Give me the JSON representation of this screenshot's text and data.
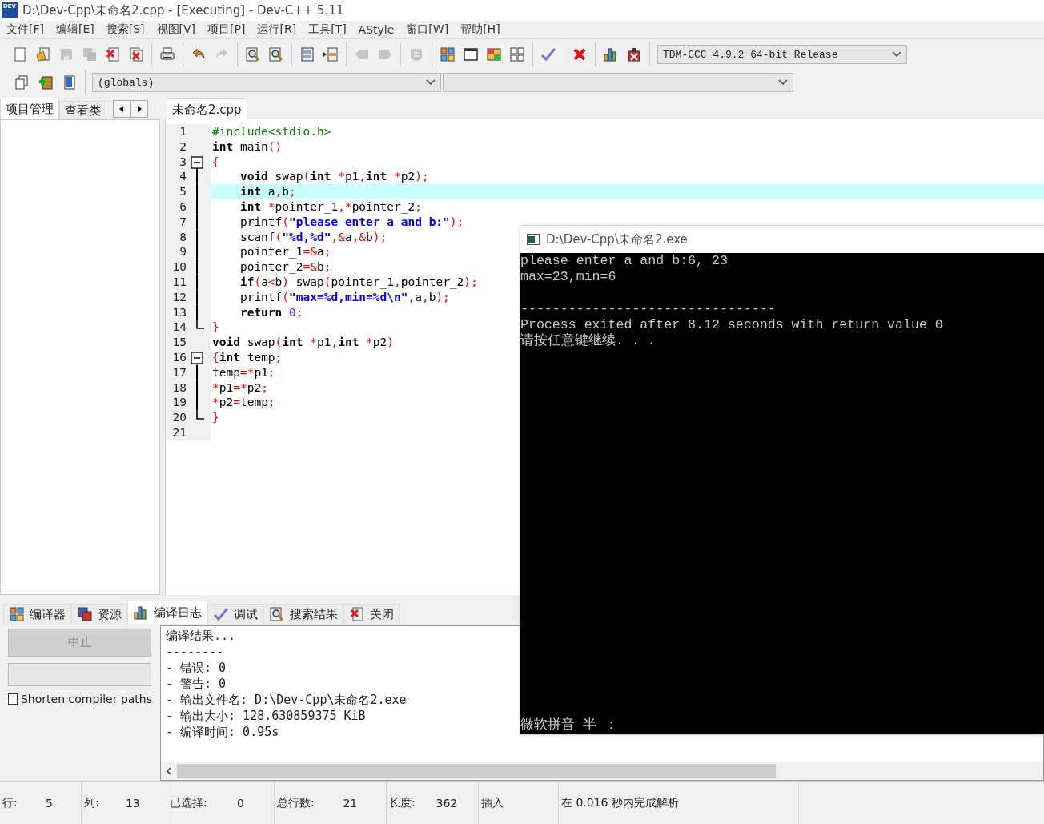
{
  "window": {
    "logo": "DEV",
    "title": "D:\\Dev-Cpp\\未命名2.cpp - [Executing] - Dev-C++ 5.11"
  },
  "menu": [
    "文件[F]",
    "编辑[E]",
    "搜索[S]",
    "视图[V]",
    "项目[P]",
    "运行[R]",
    "工具[T]",
    "AStyle",
    "窗口[W]",
    "帮助[H]"
  ],
  "toolbar": [
    [
      {
        "kind": "new",
        "disabled": false
      },
      {
        "kind": "open",
        "disabled": false
      },
      {
        "kind": "save",
        "disabled": true
      },
      {
        "kind": "saveall",
        "disabled": true
      },
      {
        "kind": "close",
        "disabled": false
      },
      {
        "kind": "closeall",
        "disabled": false
      }
    ],
    [
      {
        "kind": "print",
        "disabled": false
      }
    ],
    [
      {
        "kind": "undo",
        "disabled": false
      },
      {
        "kind": "redo",
        "disabled": true
      }
    ],
    [
      {
        "kind": "find",
        "disabled": false
      },
      {
        "kind": "replace",
        "disabled": false
      }
    ],
    [
      {
        "kind": "list",
        "disabled": false
      },
      {
        "kind": "goto",
        "disabled": false
      }
    ],
    [
      {
        "kind": "prev",
        "disabled": true
      },
      {
        "kind": "next",
        "disabled": true
      }
    ],
    [
      {
        "kind": "shield",
        "disabled": true
      }
    ],
    [
      {
        "kind": "colorgrid",
        "disabled": false
      },
      {
        "kind": "window",
        "disabled": false
      },
      {
        "kind": "palette",
        "disabled": false
      },
      {
        "kind": "grid",
        "disabled": false
      }
    ],
    [
      {
        "kind": "check",
        "disabled": false
      }
    ],
    [
      {
        "kind": "cross",
        "disabled": false
      }
    ],
    [
      {
        "kind": "chart",
        "disabled": false
      },
      {
        "kind": "chartcross",
        "disabled": false
      }
    ]
  ],
  "compiler": "TDM-GCC 4.9.2 64-bit Release",
  "toolbar2": [
    {
      "kind": "project",
      "disabled": false
    },
    {
      "kind": "add",
      "disabled": false
    },
    {
      "kind": "book",
      "disabled": false
    }
  ],
  "scope": "(globals)",
  "left_tabs": [
    {
      "label": "项目管理",
      "selected": true
    },
    {
      "label": "查看类",
      "selected": false
    }
  ],
  "editor_tabs": [
    {
      "label": "未命名2.cpp",
      "selected": true
    }
  ],
  "code": [
    {
      "number": "1",
      "current": false,
      "segments": [
        {
          "kind": "pp",
          "text": "#include<stdio.h>"
        }
      ]
    },
    {
      "number": "2",
      "current": false,
      "segments": [
        {
          "kind": "kw",
          "text": "int"
        },
        {
          "kind": "id",
          "text": " main"
        },
        {
          "kind": "sym",
          "text": "()"
        }
      ]
    },
    {
      "number": "3",
      "current": false,
      "expanded": true,
      "segments": [
        {
          "kind": "sym",
          "text": "{"
        }
      ],
      "children": [
        {
          "number": "4",
          "current": false,
          "segments": [
            {
              "kind": "kw",
              "text": "    void"
            },
            {
              "kind": "id",
              "text": " swap"
            },
            {
              "kind": "sym",
              "text": "("
            },
            {
              "kind": "kw",
              "text": "int "
            },
            {
              "kind": "sym",
              "text": "*"
            },
            {
              "kind": "id",
              "text": "p1"
            },
            {
              "kind": "sym",
              "text": ","
            },
            {
              "kind": "kw",
              "text": "int "
            },
            {
              "kind": "sym",
              "text": "*"
            },
            {
              "kind": "id",
              "text": "p2"
            },
            {
              "kind": "sym",
              "text": ");"
            }
          ]
        },
        {
          "number": "5",
          "current": true,
          "segments": [
            {
              "kind": "kw",
              "text": "    int"
            },
            {
              "kind": "id",
              "text": " a"
            },
            {
              "kind": "sym",
              "text": ","
            },
            {
              "kind": "id",
              "text": "b"
            },
            {
              "kind": "sym",
              "text": ";"
            }
          ]
        },
        {
          "number": "6",
          "current": false,
          "segments": [
            {
              "kind": "kw",
              "text": "    int "
            },
            {
              "kind": "sym",
              "text": "*"
            },
            {
              "kind": "id",
              "text": "pointer_1"
            },
            {
              "kind": "sym",
              "text": ",*"
            },
            {
              "kind": "id",
              "text": "pointer_2"
            },
            {
              "kind": "sym",
              "text": ";"
            }
          ]
        },
        {
          "number": "7",
          "current": false,
          "segments": [
            {
              "kind": "id",
              "text": "    printf"
            },
            {
              "kind": "sym",
              "text": "("
            },
            {
              "kind": "str",
              "text": "\"please enter a and b:\""
            },
            {
              "kind": "sym",
              "text": ");"
            }
          ]
        },
        {
          "number": "8",
          "current": false,
          "segments": [
            {
              "kind": "id",
              "text": "    scanf"
            },
            {
              "kind": "sym",
              "text": "("
            },
            {
              "kind": "str",
              "text": "\"%d,%d\""
            },
            {
              "kind": "sym",
              "text": ",&"
            },
            {
              "kind": "id",
              "text": "a"
            },
            {
              "kind": "sym",
              "text": ",&"
            },
            {
              "kind": "id",
              "text": "b"
            },
            {
              "kind": "sym",
              "text": ");"
            }
          ]
        },
        {
          "number": "9",
          "current": false,
          "segments": [
            {
              "kind": "id",
              "text": "    pointer_1"
            },
            {
              "kind": "sym",
              "text": "=&"
            },
            {
              "kind": "id",
              "text": "a"
            },
            {
              "kind": "sym",
              "text": ";"
            }
          ]
        },
        {
          "number": "10",
          "current": false,
          "segments": [
            {
              "kind": "id",
              "text": "    pointer_2"
            },
            {
              "kind": "sym",
              "text": "=&"
            },
            {
              "kind": "id",
              "text": "b"
            },
            {
              "kind": "sym",
              "text": ";"
            }
          ]
        },
        {
          "number": "11",
          "current": false,
          "segments": [
            {
              "kind": "kw",
              "text": "    if"
            },
            {
              "kind": "sym",
              "text": "("
            },
            {
              "kind": "id",
              "text": "a"
            },
            {
              "kind": "sym",
              "text": "<"
            },
            {
              "kind": "id",
              "text": "b"
            },
            {
              "kind": "sym",
              "text": ")"
            },
            {
              "kind": "id",
              "text": " swap"
            },
            {
              "kind": "sym",
              "text": "("
            },
            {
              "kind": "id",
              "text": "pointer_1"
            },
            {
              "kind": "sym",
              "text": ","
            },
            {
              "kind": "id",
              "text": "pointer_2"
            },
            {
              "kind": "sym",
              "text": ");"
            }
          ]
        },
        {
          "number": "12",
          "current": false,
          "segments": [
            {
              "kind": "id",
              "text": "    printf"
            },
            {
              "kind": "sym",
              "text": "("
            },
            {
              "kind": "str",
              "text": "\"max=%d,min=%d\\n\""
            },
            {
              "kind": "sym",
              "text": ","
            },
            {
              "kind": "id",
              "text": "a"
            },
            {
              "kind": "sym",
              "text": ","
            },
            {
              "kind": "id",
              "text": "b"
            },
            {
              "kind": "sym",
              "text": ");"
            }
          ]
        },
        {
          "number": "13",
          "current": false,
          "segments": [
            {
              "kind": "kw",
              "text": "    return "
            },
            {
              "kind": "num",
              "text": "0"
            },
            {
              "kind": "sym",
              "text": ";"
            }
          ]
        },
        {
          "number": "14",
          "current": false,
          "segments": [
            {
              "kind": "sym",
              "text": "}"
            }
          ]
        }
      ]
    },
    {
      "number": "15",
      "current": false,
      "segments": [
        {
          "kind": "kw",
          "text": "void"
        },
        {
          "kind": "id",
          "text": " swap"
        },
        {
          "kind": "sym",
          "text": "("
        },
        {
          "kind": "kw",
          "text": "int "
        },
        {
          "kind": "sym",
          "text": "*"
        },
        {
          "kind": "id",
          "text": "p1"
        },
        {
          "kind": "sym",
          "text": ","
        },
        {
          "kind": "kw",
          "text": "int "
        },
        {
          "kind": "sym",
          "text": "*"
        },
        {
          "kind": "id",
          "text": "p2"
        },
        {
          "kind": "sym",
          "text": ")"
        }
      ]
    },
    {
      "number": "16",
      "current": false,
      "expanded": true,
      "segments": [
        {
          "kind": "sym",
          "text": "{"
        },
        {
          "kind": "kw",
          "text": "int"
        },
        {
          "kind": "id",
          "text": " temp"
        },
        {
          "kind": "sym",
          "text": ";"
        }
      ],
      "children": [
        {
          "number": "17",
          "current": false,
          "segments": [
            {
              "kind": "id",
              "text": "temp"
            },
            {
              "kind": "sym",
              "text": "=*"
            },
            {
              "kind": "id",
              "text": "p1"
            },
            {
              "kind": "sym",
              "text": ";"
            }
          ]
        },
        {
          "number": "18",
          "current": false,
          "segments": [
            {
              "kind": "sym",
              "text": "*"
            },
            {
              "kind": "id",
              "text": "p1"
            },
            {
              "kind": "sym",
              "text": "=*"
            },
            {
              "kind": "id",
              "text": "p2"
            },
            {
              "kind": "sym",
              "text": ";"
            }
          ]
        },
        {
          "number": "19",
          "current": false,
          "segments": [
            {
              "kind": "sym",
              "text": "*"
            },
            {
              "kind": "id",
              "text": "p2"
            },
            {
              "kind": "sym",
              "text": "="
            },
            {
              "kind": "id",
              "text": "temp"
            },
            {
              "kind": "sym",
              "text": ";"
            }
          ]
        },
        {
          "number": "20",
          "current": false,
          "segments": [
            {
              "kind": "sym",
              "text": "}"
            }
          ]
        }
      ]
    },
    {
      "number": "21",
      "current": false
    }
  ],
  "bottom_tabs": [
    {
      "kind": "colorgrid",
      "label": "编译器",
      "selected": false
    },
    {
      "kind": "pages",
      "label": "资源",
      "selected": false
    },
    {
      "kind": "chart",
      "label": "编译日志",
      "selected": true
    },
    {
      "kind": "check",
      "label": "调试",
      "selected": false
    },
    {
      "kind": "find",
      "label": "搜索结果",
      "selected": false
    },
    {
      "kind": "close",
      "label": "关闭",
      "selected": false
    }
  ],
  "abort_button": {
    "label": "中止",
    "disabled": true
  },
  "progress": {
    "level": 0
  },
  "shorten_paths": {
    "label": "Shorten compiler paths",
    "checked": false
  },
  "log": [
    "编译结果...",
    "--------",
    "- 错误: 0",
    "- 警告: 0",
    "- 输出文件名: D:\\Dev-Cpp\\未命名2.exe",
    "- 输出大小: 128.630859375 KiB",
    "- 编译时间: 0.95s"
  ],
  "status_bar": [
    {
      "label": "行:",
      "value": "5"
    },
    {
      "label": "列:",
      "value": "13"
    },
    {
      "label": "已选择:",
      "value": "0"
    },
    {
      "label": "总行数:",
      "value": "21"
    },
    {
      "label": "长度:",
      "value": "362"
    },
    {
      "label": "插入"
    },
    {
      "label": "在 0.016 秒内完成解析"
    }
  ],
  "console": {
    "title": "D:\\Dev-Cpp\\未命名2.exe",
    "blocks": [
      [
        "please enter a and b:6, 23",
        "max=23,min=6"
      ],
      [
        "--------------------------------",
        "Process exited after 8.12 seconds with return value 0",
        "请按任意键继续. . ."
      ]
    ],
    "ime": "微软拼音 半 ："
  }
}
